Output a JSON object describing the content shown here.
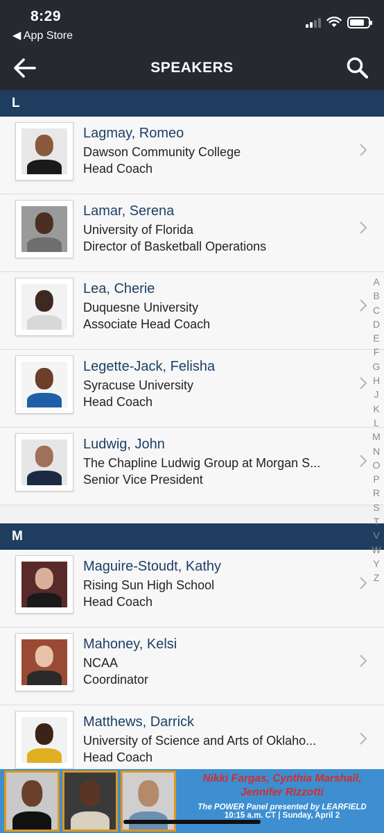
{
  "status_bar": {
    "time": "8:29",
    "back_label": "App Store"
  },
  "nav": {
    "title": "SPEAKERS",
    "back_icon": "back-arrow-icon",
    "search_icon": "search-icon"
  },
  "sections": [
    {
      "letter": "L",
      "speakers": [
        {
          "name": "Lagmay, Romeo",
          "organization": "Dawson Community College",
          "title": "Head Coach"
        },
        {
          "name": "Lamar, Serena",
          "organization": "University of Florida",
          "title": "Director of Basketball Operations"
        },
        {
          "name": "Lea, Cherie",
          "organization": "Duquesne University",
          "title": "Associate Head Coach"
        },
        {
          "name": "Legette-Jack, Felisha",
          "organization": "Syracuse University",
          "title": "Head Coach"
        },
        {
          "name": "Ludwig, John",
          "organization": "The Chapline Ludwig Group at Morgan S...",
          "title": "Senior Vice President"
        }
      ]
    },
    {
      "letter": "M",
      "speakers": [
        {
          "name": "Maguire-Stoudt, Kathy",
          "organization": "Rising Sun High School",
          "title": "Head Coach"
        },
        {
          "name": "Mahoney, Kelsi",
          "organization": "NCAA",
          "title": "Coordinator"
        },
        {
          "name": "Matthews, Darrick",
          "organization": "University of Science and Arts of Oklaho...",
          "title": "Head Coach"
        }
      ]
    }
  ],
  "index_letters": [
    "A",
    "B",
    "C",
    "D",
    "E",
    "F",
    "G",
    "H",
    "J",
    "K",
    "L",
    "M",
    "N",
    "O",
    "P",
    "R",
    "S",
    "T",
    "V",
    "W",
    "Y",
    "Z"
  ],
  "banner": {
    "names_line1": "Nikki Fargas, Cynthia Marshall,",
    "names_line2": "Jennifer Rizzotti",
    "subtitle": "The POWER Panel presented by LEARFIELD",
    "when": "10:15 a.m. CT | Sunday, April 2"
  },
  "colors": {
    "header_bg": "#262a30",
    "section_bg": "#1e3d5f",
    "name_color": "#1d3f66",
    "banner_bg": "#3d8fd1"
  }
}
